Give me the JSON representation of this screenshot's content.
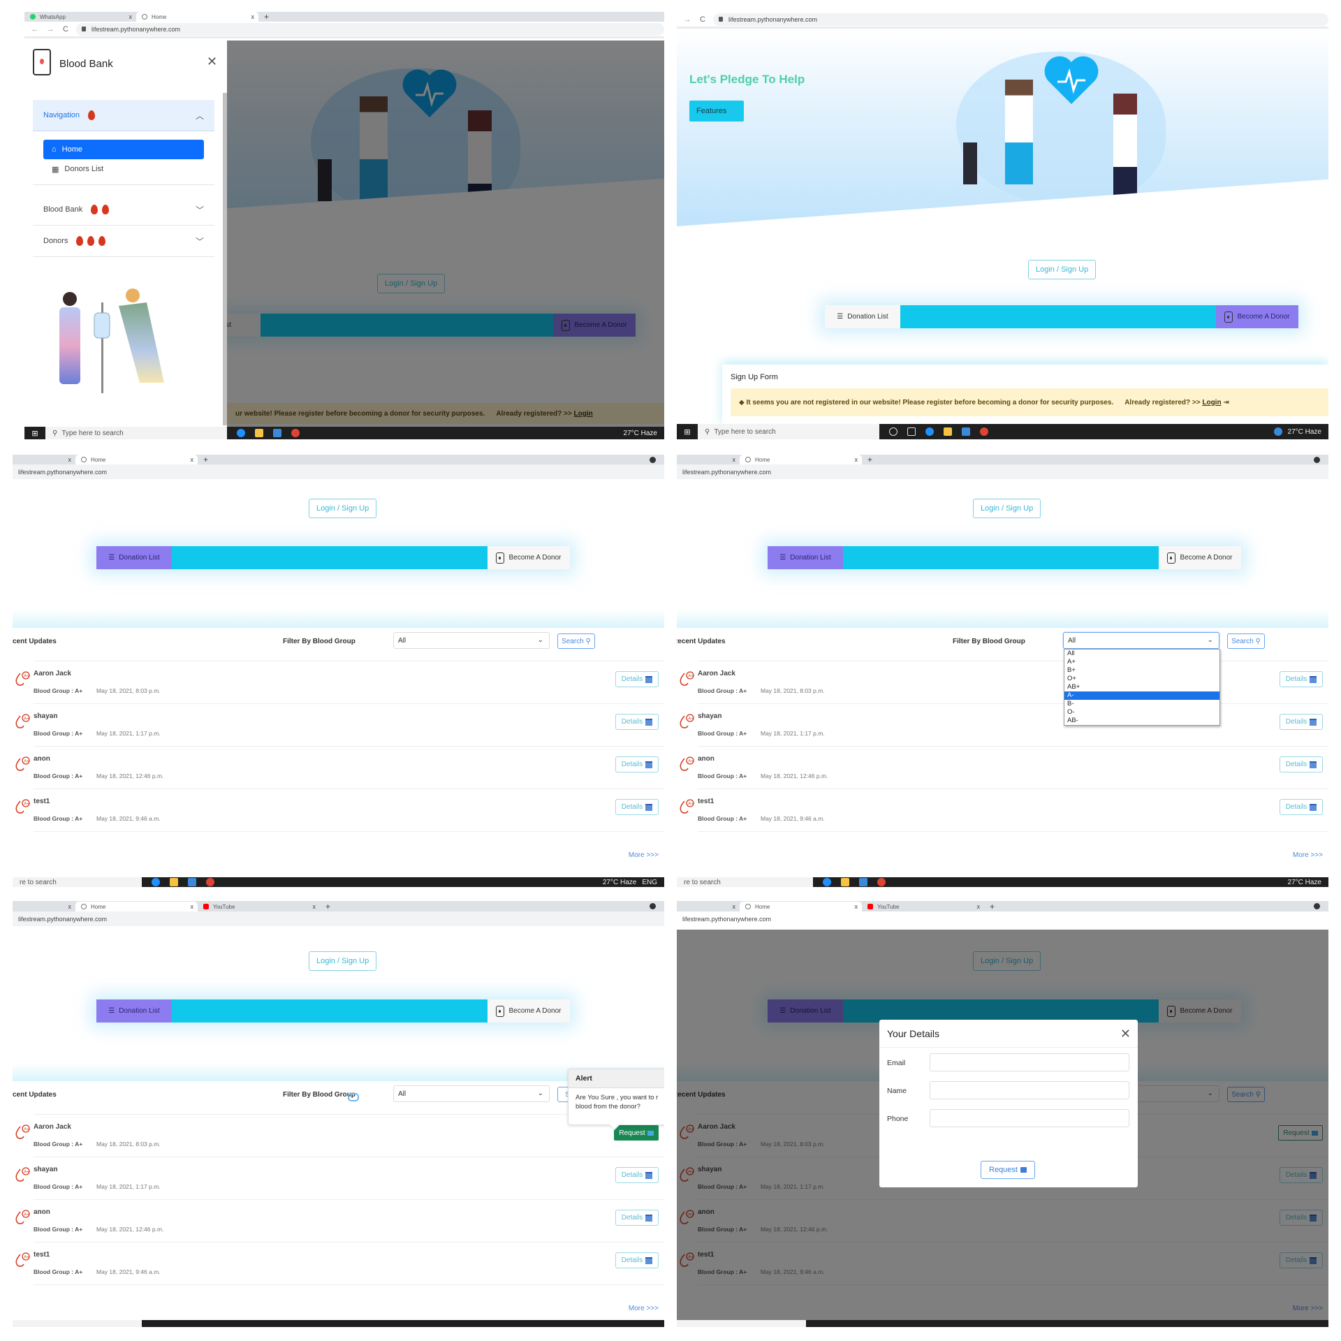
{
  "browser": {
    "url": "lifestream.pythonanywhere.com",
    "tabs_p1": [
      {
        "title": "WhatsApp",
        "icon": "whatsapp-icon",
        "color": "#25d366"
      },
      {
        "title": "Home",
        "icon": "globe-icon",
        "color": "#777777"
      }
    ],
    "tabs_late": [
      {
        "title": "",
        "icon": "",
        "color": ""
      },
      {
        "title": "Home",
        "icon": "globe-icon",
        "color": "#777777"
      },
      {
        "title": "YouTube",
        "icon": "youtube-icon",
        "color": "#ff0000"
      }
    ],
    "new_tab": "+",
    "close": "x"
  },
  "taskbar": {
    "search_placeholder": "Type here to search",
    "search_partial": "re to search",
    "weather": "27°C  Haze",
    "lang": "ENG"
  },
  "sidebar": {
    "brand": "Blood Bank",
    "sections": [
      {
        "label": "Navigation",
        "drops": 1,
        "open": true,
        "items": [
          {
            "label": "Home",
            "icon": "home-icon",
            "active": true
          },
          {
            "label": "Donors List",
            "icon": "table-icon",
            "active": false
          }
        ]
      },
      {
        "label": "Blood Bank",
        "drops": 2,
        "open": false
      },
      {
        "label": "Donors",
        "drops": 3,
        "open": false
      }
    ]
  },
  "hero": {
    "title": "Let's Pledge To Help",
    "features_label": "Features"
  },
  "actions": {
    "login_label": "Login / Sign Up",
    "donation_list_label": "Donation List",
    "donation_list_partial": "n List",
    "become_donor_label": "Become A Donor"
  },
  "signup": {
    "title": "Sign Up Form",
    "warning": "It seems you are not registered in our website! Please register before becoming a donor for security purposes.",
    "warning_partial": "ur website! Please register before becoming a donor for security purposes.",
    "already": "Already registered? >>",
    "login_link": "Login"
  },
  "recent": {
    "title": "Recent Updates",
    "title_partial": "cent Updates",
    "filter_label": "Filter By Blood Group",
    "select_value": "All",
    "search_label": "Search",
    "options": [
      "All",
      "A+",
      "B+",
      "O+",
      "AB+",
      "A-",
      "B-",
      "O-",
      "AB-"
    ],
    "highlighted_option": "A-",
    "rows": [
      {
        "name": "Aaron Jack",
        "group": "Blood Group : A+",
        "date": "May 18, 2021, 8:03 p.m."
      },
      {
        "name": "shayan",
        "group": "Blood Group : A+",
        "date": "May 18, 2021, 1:17 p.m."
      },
      {
        "name": "anon",
        "group": "Blood Group : A+",
        "date": "May 18, 2021, 12:46 p.m."
      },
      {
        "name": "test1",
        "group": "Blood Group : A+",
        "date": "May 18, 2021, 9:46 a.m."
      }
    ],
    "details_label": "Details",
    "request_label": "Request",
    "more_label": "More >>>"
  },
  "alert": {
    "title": "Alert",
    "body_line1": "Are You Sure , you want to r",
    "body_line2": "blood from the donor?"
  },
  "modal": {
    "title": "Your Details",
    "fields": [
      {
        "label": "Email",
        "value": ""
      },
      {
        "label": "Name",
        "value": ""
      },
      {
        "label": "Phone",
        "value": ""
      }
    ],
    "submit_label": "Request"
  },
  "colors": {
    "accent_cyan": "#10c8ec",
    "accent_purple": "#8c7cf0",
    "hero_title": "#4fcfa9",
    "primary_blue": "#0d6efd",
    "success_green": "#198754",
    "warning_bg": "#fff3cd",
    "drop_red": "#d5381c"
  }
}
